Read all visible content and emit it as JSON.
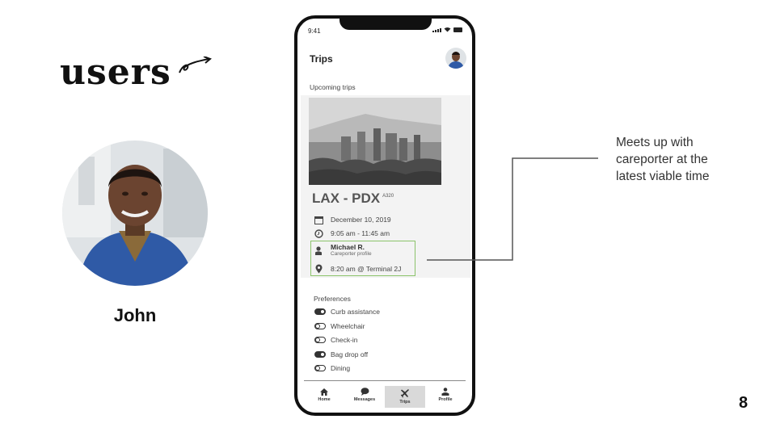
{
  "logo": {
    "text": "users"
  },
  "persona": {
    "name": "John"
  },
  "phone": {
    "status_time": "9:41",
    "title": "Trips",
    "section_label": "Upcoming trips",
    "trip": {
      "route": "LAX - PDX",
      "aircraft": "A320",
      "date": "December 10, 2019",
      "time": "9:05 am - 11:45 am",
      "careporter_name": "Michael R.",
      "careporter_sub": "Careporter profile",
      "meetup": "8:20 am @ Terminal 2J"
    },
    "preferences": {
      "label": "Preferences",
      "items": [
        {
          "label": "Curb assistance",
          "on": true
        },
        {
          "label": "Wheelchair",
          "on": false
        },
        {
          "label": "Check-in",
          "on": false
        },
        {
          "label": "Bag drop off",
          "on": true
        },
        {
          "label": "Dining",
          "on": false
        }
      ]
    },
    "tabs": [
      {
        "label": "Home",
        "icon": "home-icon"
      },
      {
        "label": "Messages",
        "icon": "chat-bubble-icon"
      },
      {
        "label": "Trips",
        "icon": "airplane-icon",
        "active": true
      },
      {
        "label": "Profile",
        "icon": "person-icon"
      }
    ]
  },
  "annotation": {
    "text_lines": [
      "Meets up with",
      "careporter at the",
      "latest viable time"
    ]
  },
  "page_number": "8",
  "colors": {
    "highlight": "#8bc36a",
    "tab_active": "#d9d9d9"
  }
}
